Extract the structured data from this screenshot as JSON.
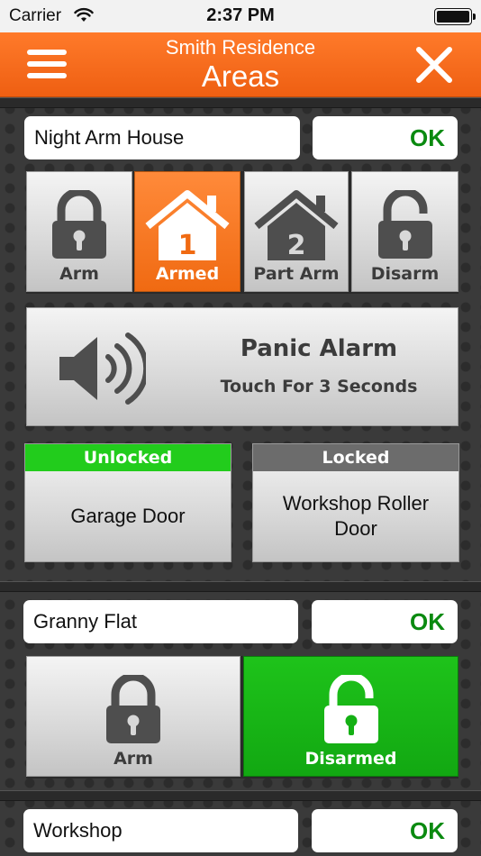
{
  "status_bar": {
    "carrier": "Carrier",
    "time": "2:37 PM"
  },
  "nav": {
    "subtitle": "Smith Residence",
    "title": "Areas"
  },
  "areas": [
    {
      "name": "Night Arm House",
      "status": "OK",
      "buttons": [
        {
          "label": "Arm"
        },
        {
          "label": "Armed",
          "number": "1"
        },
        {
          "label": "Part Arm",
          "number": "2"
        },
        {
          "label": "Disarm"
        }
      ],
      "panic": {
        "title": "Panic Alarm",
        "subtitle": "Touch For 3 Seconds"
      },
      "doors": [
        {
          "state": "Unlocked",
          "name": "Garage Door"
        },
        {
          "state": "Locked",
          "name": "Workshop Roller Door"
        }
      ]
    },
    {
      "name": "Granny Flat",
      "status": "OK",
      "buttons": [
        {
          "label": "Arm"
        },
        {
          "label": "Disarmed"
        }
      ]
    },
    {
      "name": "Workshop",
      "status": "OK"
    }
  ],
  "colors": {
    "nav_orange": "#f26b1d",
    "armed_orange": "#f47a20",
    "disarmed_green": "#14b014",
    "unlocked_green": "#22cc1c",
    "locked_gray": "#6c6c6c",
    "ok_green": "#0a8a10"
  }
}
